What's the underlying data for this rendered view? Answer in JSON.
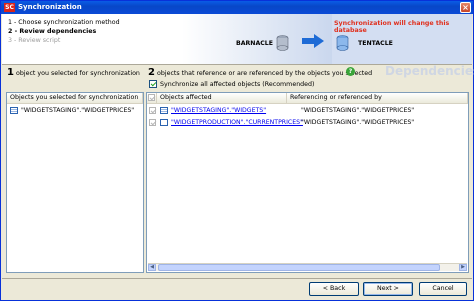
{
  "window": {
    "title": "Synchronization",
    "logo": "SC"
  },
  "header": {
    "steps": [
      {
        "label": "1 - Choose synchronization method",
        "state": "done"
      },
      {
        "label": "2 - Review dependencies",
        "state": "active"
      },
      {
        "label": "3 - Review script",
        "state": "inactive"
      }
    ],
    "warning": "Synchronization will change this database",
    "source_db": "BARNACLE",
    "target_db": "TENTACLE"
  },
  "left": {
    "count": "1",
    "heading": "object you selected for synchronization",
    "column": "Objects you selected for synchronization",
    "rows": [
      "\"WIDGETSTAGING\".\"WIDGETPRICES\""
    ]
  },
  "right": {
    "count": "2",
    "heading": "objects that reference or are referenced by the objects you selected",
    "section_title": "Dependencies",
    "sync_all_label": "Synchronize all affected objects (Recommended)",
    "columns": {
      "affected": "Objects affected",
      "referencing": "Referencing or referenced by"
    },
    "rows": [
      {
        "affected": "\"WIDGETSTAGING\".\"WIDGETS\"",
        "referencing": "\"WIDGETSTAGING\".\"WIDGETPRICES\"",
        "icon": "table-icon"
      },
      {
        "affected": "\"WIDGETPRODUCTION\".\"CURRENTPRICES\"",
        "referencing": "\"WIDGETSTAGING\".\"WIDGETPRICES\"",
        "icon": "sql-view-icon"
      }
    ]
  },
  "buttons": {
    "back": "< Back",
    "next": "Next >",
    "cancel": "Cancel"
  },
  "colors": {
    "accent": "#0a4ad6",
    "warning": "#e0301e",
    "link": "#0000ee"
  }
}
